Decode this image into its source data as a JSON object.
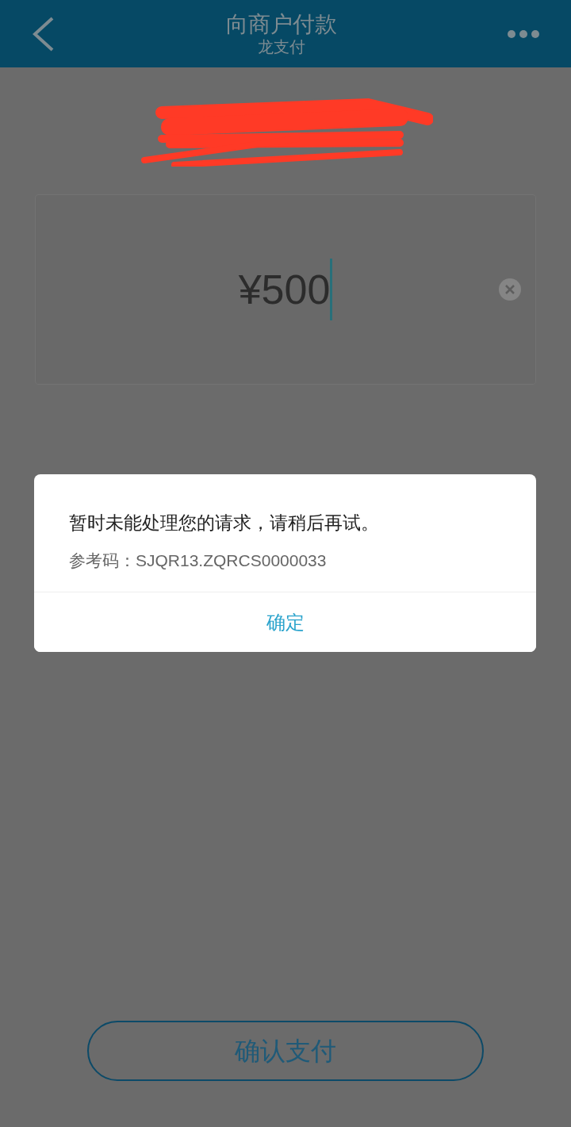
{
  "header": {
    "title": "向商户付款",
    "subtitle": "龙支付"
  },
  "amount_field": {
    "value": "¥500"
  },
  "dialog": {
    "message": "暂时未能处理您的请求，请稍后再试。",
    "reference": "参考码：SJQR13.ZQRCS0000033",
    "button": "确定"
  },
  "confirm_button": "确认支付"
}
